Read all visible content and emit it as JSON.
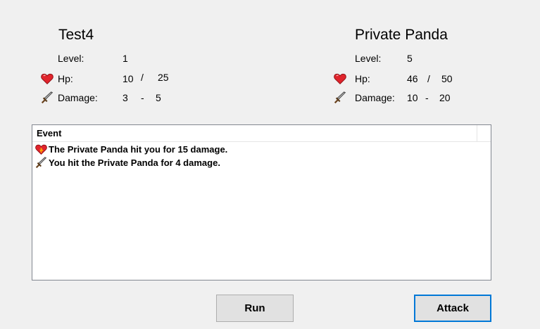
{
  "player": {
    "name": "Test4",
    "level_label": "Level:",
    "level": "1",
    "hp_label": "Hp:",
    "hp_current": "10",
    "hp_sep": "/",
    "hp_max": "25",
    "damage_label": "Damage:",
    "damage_min": "3",
    "damage_sep": "-",
    "damage_max": "5"
  },
  "enemy": {
    "name": "Private Panda",
    "level_label": "Level:",
    "level": "5",
    "hp_label": "Hp:",
    "hp_current": "46",
    "hp_sep": "/",
    "hp_max": "50",
    "damage_label": "Damage:",
    "damage_min": "10",
    "damage_sep": "-",
    "damage_max": "20"
  },
  "events": {
    "header": "Event",
    "rows": [
      {
        "icon": "heart-icon",
        "text": "The Private Panda hit you for 15 damage."
      },
      {
        "icon": "sword-icon",
        "text": "You hit the Private Panda for 4 damage."
      }
    ]
  },
  "buttons": {
    "run": "Run",
    "attack": "Attack"
  },
  "colors": {
    "heart": "#e0242c",
    "accent": "#0078d7",
    "background": "#f0f0f0"
  }
}
